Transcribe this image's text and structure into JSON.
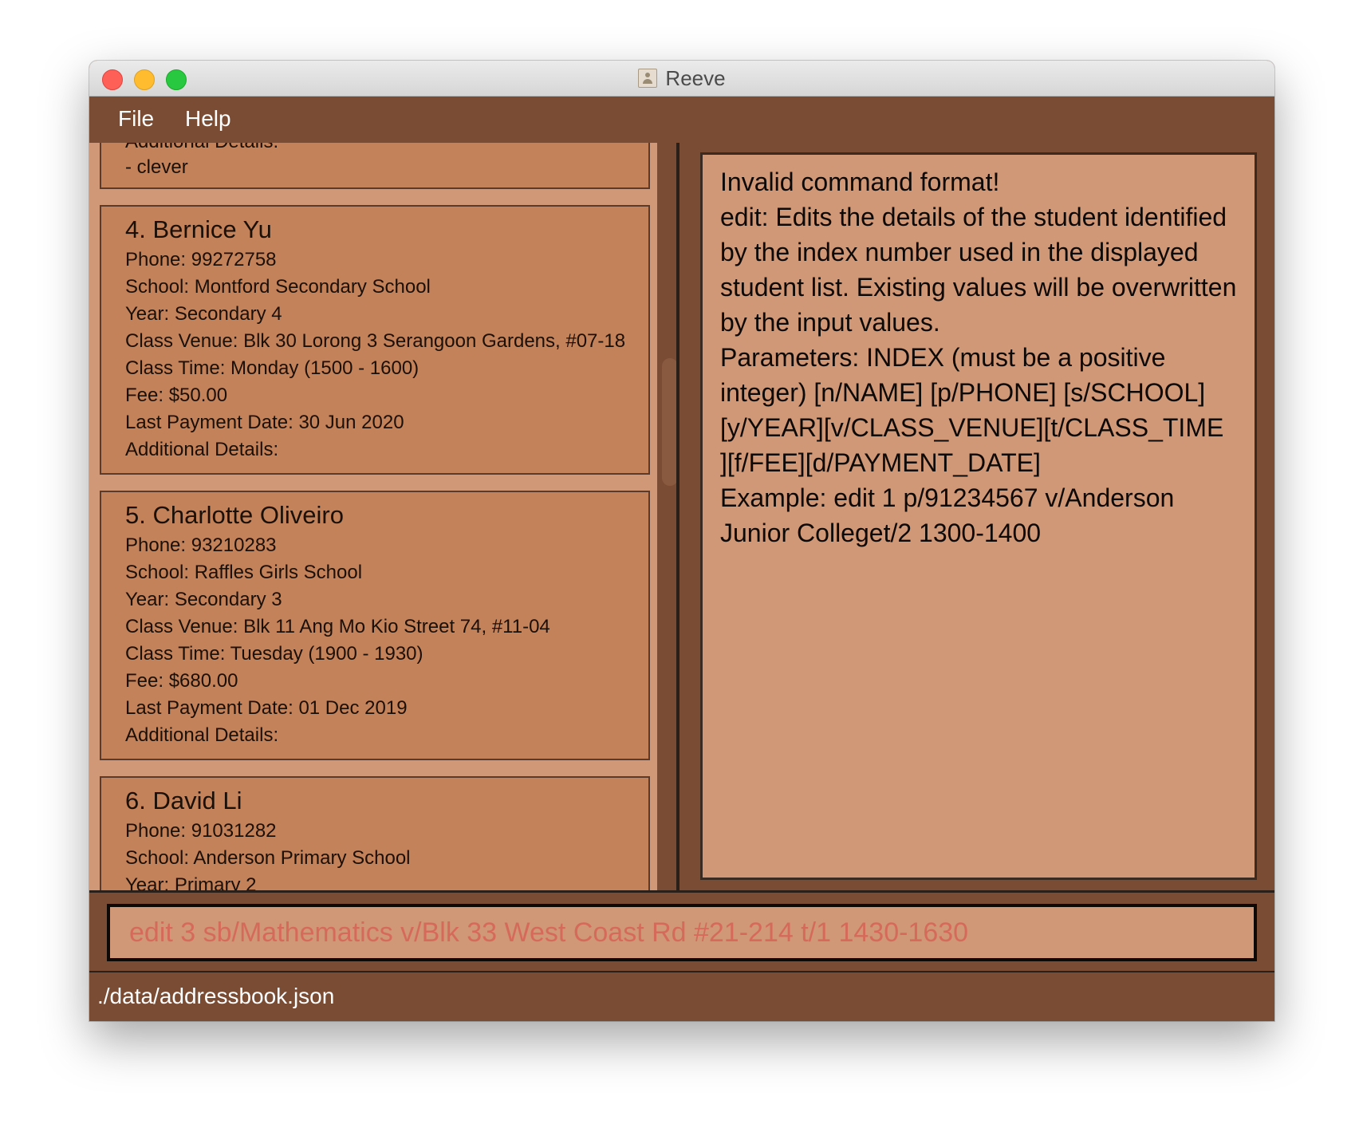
{
  "window": {
    "title": "Reeve"
  },
  "menu": {
    "file": "File",
    "help": "Help"
  },
  "students": [
    {
      "partial_lines": [
        "Additional Details:",
        "- clever"
      ]
    },
    {
      "name": "4.  Bernice Yu",
      "lines": [
        "Phone: 99272758",
        "School: Montford Secondary School",
        "Year: Secondary 4",
        "Class Venue: Blk 30 Lorong 3 Serangoon Gardens, #07-18",
        "Class Time: Monday (1500 - 1600)",
        "Fee: $50.00",
        "Last Payment Date: 30 Jun 2020",
        "Additional Details:"
      ]
    },
    {
      "name": "5.  Charlotte Oliveiro",
      "lines": [
        "Phone: 93210283",
        "School: Raffles Girls School",
        "Year: Secondary 3",
        "Class Venue: Blk 11 Ang Mo Kio Street 74, #11-04",
        "Class Time: Tuesday (1900 - 1930)",
        "Fee: $680.00",
        "Last Payment Date: 01 Dec 2019",
        "Additional Details:"
      ]
    },
    {
      "name": "6.  David Li",
      "lines": [
        "Phone: 91031282",
        "School: Anderson Primary School",
        "Year: Primary 2"
      ]
    }
  ],
  "result_display": {
    "text": "Invalid command format!\nedit: Edits the details of the student identified by the index number used in the displayed student list. Existing values will be overwritten by the input values.\nParameters: INDEX (must be a positive integer) [n/NAME] [p/PHONE] [s/SCHOOL] [y/YEAR][v/CLASS_VENUE][t/CLASS_TIME ][f/FEE][d/PAYMENT_DATE]\nExample: edit 1 p/91234567 v/Anderson Junior Colleget/2 1300-1400"
  },
  "command_box": {
    "value": "edit 3 sb/Mathematics v/Blk 33 West Coast Rd #21-214 t/1 1430-1630"
  },
  "status_bar": {
    "path": "./data/addressbook.json"
  },
  "colors": {
    "window_bg": "#7a4c34",
    "panel_bg": "#d09877",
    "card_bg": "#c4825a",
    "command_text": "#d66a5a"
  }
}
